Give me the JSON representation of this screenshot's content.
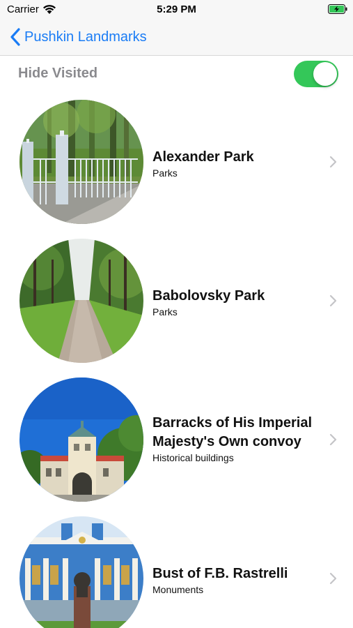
{
  "status_bar": {
    "carrier": "Carrier",
    "time": "5:29 PM"
  },
  "nav": {
    "back_label": "Pushkin Landmarks"
  },
  "filter": {
    "label": "Hide Visited",
    "toggle_on": true,
    "toggle_color": "#34c759"
  },
  "landmarks": [
    {
      "title": "Alexander Park",
      "category": "Parks"
    },
    {
      "title": "Babolovsky Park",
      "category": "Parks"
    },
    {
      "title": "Barracks of His Imperial Majesty's Own convoy",
      "category": "Historical buildings"
    },
    {
      "title": "Bust of F.B. Rastrelli",
      "category": "Monuments"
    }
  ],
  "colors": {
    "accent": "#1a7cf5",
    "secondary_text": "#8a8a8e",
    "chevron": "#c4c4c7"
  }
}
